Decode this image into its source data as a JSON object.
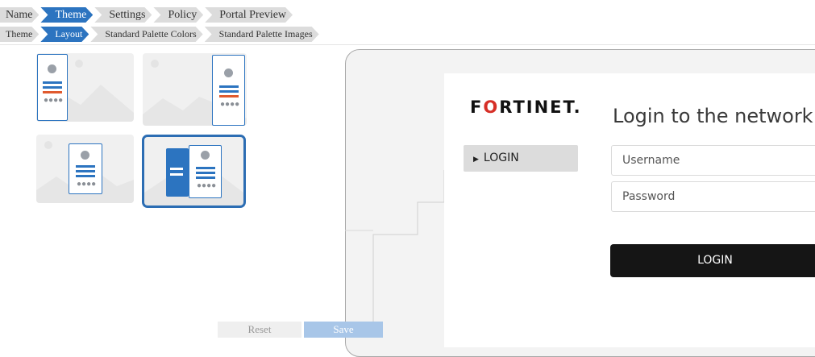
{
  "wizard_steps": [
    "Name",
    "Theme",
    "Settings",
    "Policy",
    "Portal Preview"
  ],
  "wizard_active_index": 1,
  "sub_steps": [
    "Theme",
    "Layout",
    "Standard Palette Colors",
    "Standard Palette Images"
  ],
  "sub_active_index": 1,
  "layout_options": [
    "card-left",
    "card-right",
    "card-center",
    "card-with-side-panel"
  ],
  "selected_layout": "card-with-side-panel",
  "preview": {
    "logo_text": "FORTINET.",
    "menu_item": "LOGIN",
    "menu_icon": "triangle-right-icon",
    "title": "Login to the network",
    "username_placeholder": "Username",
    "password_placeholder": "Password",
    "login_button": "LOGIN"
  },
  "footer": {
    "reset_label": "Reset",
    "save_label": "Save"
  },
  "colors": {
    "accent": "#2c74c0",
    "brand_red": "#d62f27",
    "login_button": "#151515"
  }
}
